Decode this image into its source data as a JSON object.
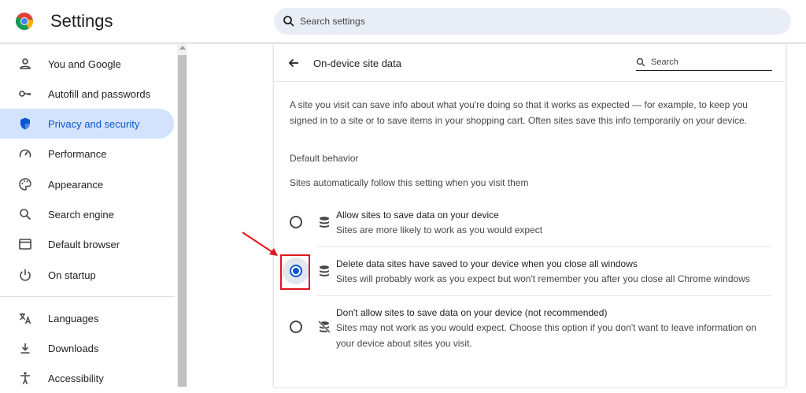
{
  "app": {
    "title": "Settings"
  },
  "search": {
    "placeholder": "Search settings"
  },
  "sidebar": {
    "items": [
      {
        "label": "You and Google",
        "icon": "person-icon",
        "active": false
      },
      {
        "label": "Autofill and passwords",
        "icon": "key-icon",
        "active": false
      },
      {
        "label": "Privacy and security",
        "icon": "shield-icon",
        "active": true
      },
      {
        "label": "Performance",
        "icon": "speedometer-icon",
        "active": false
      },
      {
        "label": "Appearance",
        "icon": "palette-icon",
        "active": false
      },
      {
        "label": "Search engine",
        "icon": "search-icon",
        "active": false
      },
      {
        "label": "Default browser",
        "icon": "browser-window-icon",
        "active": false
      },
      {
        "label": "On startup",
        "icon": "power-icon",
        "active": false
      },
      {
        "label": "Languages",
        "icon": "translate-icon",
        "active": false
      },
      {
        "label": "Downloads",
        "icon": "download-icon",
        "active": false
      },
      {
        "label": "Accessibility",
        "icon": "accessibility-icon",
        "active": false
      }
    ]
  },
  "page": {
    "title": "On-device site data",
    "search_placeholder": "Search",
    "description": "A site you visit can save info about what you're doing so that it works as expected — for example, to keep you signed in to a site or to save items in your shopping cart. Often sites save this info temporarily on your device.",
    "section_title": "Default behavior",
    "section_subtitle": "Sites automatically follow this setting when you visit them",
    "options": [
      {
        "title": "Allow sites to save data on your device",
        "desc": "Sites are more likely to work as you would expect",
        "icon": "database-icon",
        "selected": false
      },
      {
        "title": "Delete data sites have saved to your device when you close all windows",
        "desc": "Sites will probably work as you expect but won't remember you after you close all Chrome windows",
        "icon": "database-icon",
        "selected": true
      },
      {
        "title": "Don't allow sites to save data on your device (not recommended)",
        "desc": "Sites may not work as you would expect. Choose this option if you don't want to leave information on your device about sites you visit.",
        "icon": "database-off-icon",
        "selected": false
      }
    ]
  },
  "colors": {
    "accent": "#0b57d0",
    "active_bg": "#d3e3fd",
    "annotation": "#e0141e"
  }
}
